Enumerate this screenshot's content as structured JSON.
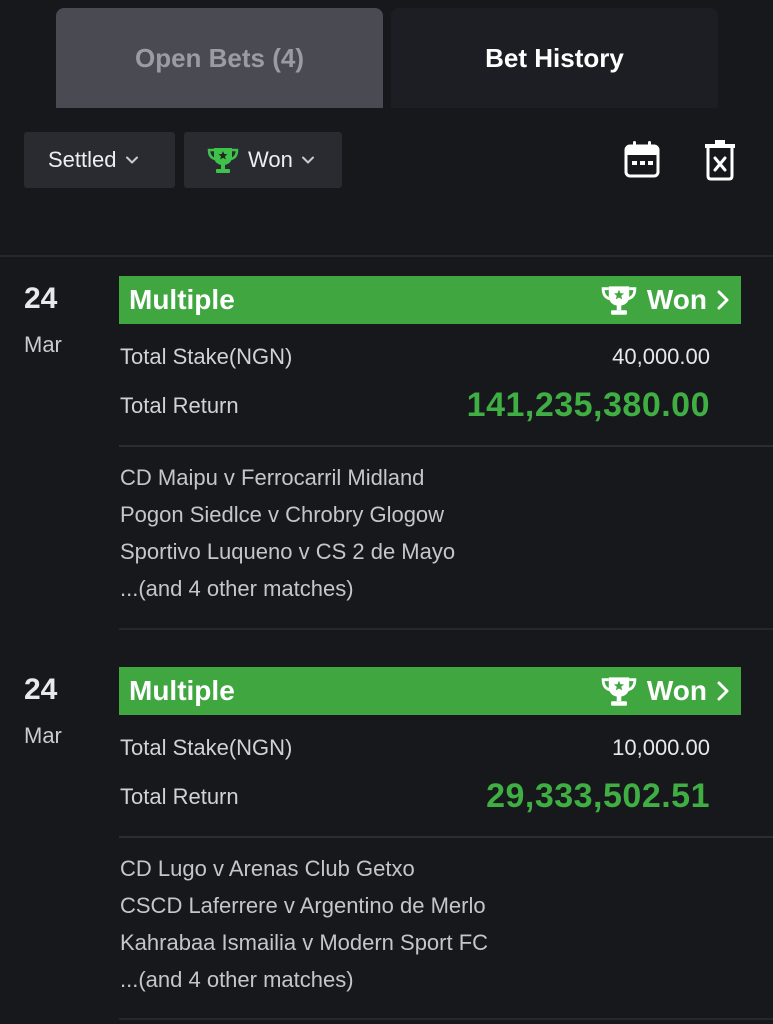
{
  "tabs": {
    "open_bets": "Open Bets (4)",
    "bet_history": "Bet History"
  },
  "filters": {
    "status": "Settled",
    "result": "Won"
  },
  "toolbar": {
    "calendar_icon": "calendar-icon",
    "clear_icon": "trash-x-icon"
  },
  "colors": {
    "accent_green": "#3fa640",
    "return_green": "#3fae43",
    "background": "#17181c"
  },
  "bets": [
    {
      "day": "24",
      "month": "Mar",
      "type": "Multiple",
      "status": "Won",
      "stake_label": "Total Stake(NGN)",
      "stake": "40,000.00",
      "return_label": "Total Return",
      "return": "141,235,380.00",
      "matches": [
        "CD Maipu v Ferrocarril Midland",
        "Pogon Siedlce v Chrobry Glogow",
        "Sportivo Luqueno v CS 2 de Mayo",
        "...(and 4 other matches)"
      ]
    },
    {
      "day": "24",
      "month": "Mar",
      "type": "Multiple",
      "status": "Won",
      "stake_label": "Total Stake(NGN)",
      "stake": "10,000.00",
      "return_label": "Total Return",
      "return": "29,333,502.51",
      "matches": [
        "CD Lugo v Arenas Club Getxo",
        "CSCD Laferrere v Argentino de Merlo",
        "Kahrabaa Ismailia v Modern Sport FC",
        "...(and 4 other matches)"
      ]
    }
  ]
}
